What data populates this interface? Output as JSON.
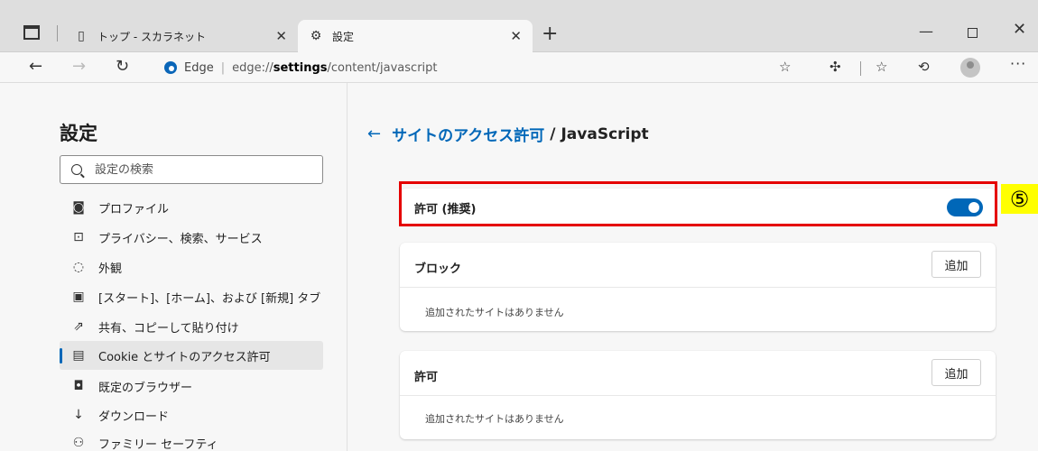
{
  "browser": {
    "tabs": [
      {
        "title": "トップ - スカラネット",
        "icon": "page-icon",
        "active": false
      },
      {
        "title": "設定",
        "icon": "gear-icon",
        "active": true
      }
    ],
    "new_tab": "+",
    "window": {
      "minimize": "—",
      "close": "✕"
    },
    "address": {
      "brand": "Edge",
      "separator": "|",
      "url_pre": "edge://",
      "url_main": "settings",
      "url_post": "/content/javascript"
    },
    "more": "···"
  },
  "sidebar": {
    "title": "設定",
    "search_placeholder": "設定の検索",
    "items": [
      {
        "label": "プロファイル",
        "icon": "profile-icon",
        "glyph": "◙"
      },
      {
        "label": "プライバシー、検索、サービス",
        "icon": "lock-icon",
        "glyph": "⊡"
      },
      {
        "label": "外観",
        "icon": "palette-icon",
        "glyph": "◌"
      },
      {
        "label": "[スタート]、[ホーム]、および [新規] タブ",
        "icon": "home-tabs-icon",
        "glyph": "▣"
      },
      {
        "label": "共有、コピーして貼り付け",
        "icon": "share-icon",
        "glyph": "⇗"
      },
      {
        "label": "Cookie とサイトのアクセス許可",
        "icon": "cookie-permissions-icon",
        "glyph": "▤",
        "active": true
      },
      {
        "label": "既定のブラウザー",
        "icon": "default-browser-icon",
        "glyph": "◘"
      },
      {
        "label": "ダウンロード",
        "icon": "download-icon",
        "glyph": "↓"
      },
      {
        "label": "ファミリー セーフティ",
        "icon": "family-icon",
        "glyph": "⚇"
      }
    ]
  },
  "main": {
    "breadcrumb": {
      "back": "←",
      "parent": "サイトのアクセス許可",
      "separator": "/",
      "current": "JavaScript"
    },
    "allow_toggle": {
      "label": "許可 (推奨)",
      "on": true
    },
    "block_section": {
      "title": "ブロック",
      "add_label": "追加",
      "empty": "追加されたサイトはありません"
    },
    "allow_section": {
      "title": "許可",
      "add_label": "追加",
      "empty": "追加されたサイトはありません"
    }
  },
  "annotation": {
    "label": "⑤",
    "highlight_color": "#e50000",
    "callout_color": "#ffff00"
  },
  "colors": {
    "accent": "#0067b8"
  }
}
